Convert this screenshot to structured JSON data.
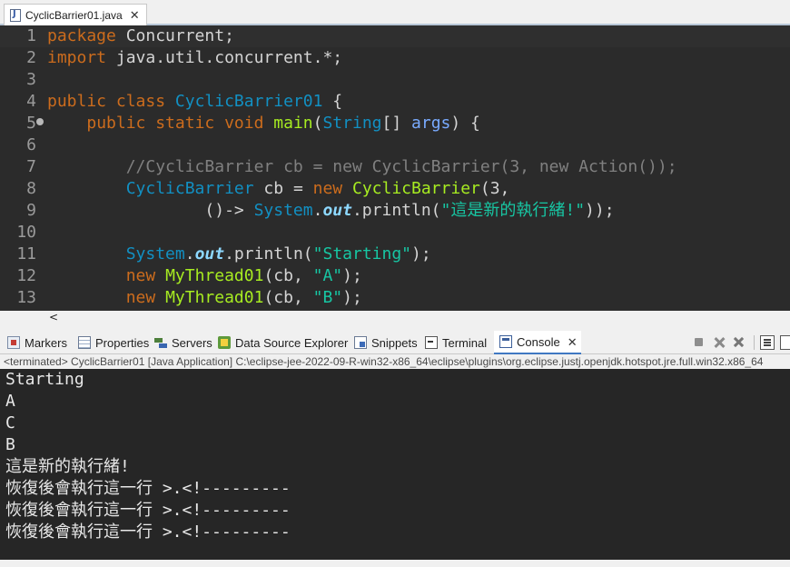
{
  "editor_tab": {
    "title": "CyclicBarrier01.java",
    "close": "✕"
  },
  "code": {
    "lines": [
      {
        "n": "1",
        "parts": [
          [
            "kw",
            "package"
          ],
          [
            "pkg",
            " Concurrent;"
          ]
        ]
      },
      {
        "n": "2",
        "parts": [
          [
            "kw",
            "import"
          ],
          [
            "pkg",
            " java.util.concurrent.*;"
          ]
        ]
      },
      {
        "n": "3",
        "parts": []
      },
      {
        "n": "4",
        "parts": [
          [
            "kw",
            "public class "
          ],
          [
            "ty",
            "CyclicBarrier01"
          ],
          [
            "pkg",
            " {"
          ]
        ]
      },
      {
        "n": "5",
        "parts": [
          [
            "pkg",
            "    "
          ],
          [
            "kw",
            "public static void "
          ],
          [
            "fn",
            "main"
          ],
          [
            "pkg",
            "("
          ],
          [
            "ty",
            "String"
          ],
          [
            "pkg",
            "[] "
          ],
          [
            "pm",
            "args"
          ],
          [
            "pkg",
            ") {"
          ]
        ]
      },
      {
        "n": "6",
        "parts": []
      },
      {
        "n": "7",
        "parts": [
          [
            "cm",
            "        //CyclicBarrier cb = new CyclicBarrier(3, new Action());"
          ]
        ]
      },
      {
        "n": "8",
        "parts": [
          [
            "pkg",
            "        "
          ],
          [
            "ty",
            "CyclicBarrier"
          ],
          [
            "pkg",
            " cb = "
          ],
          [
            "kw",
            "new "
          ],
          [
            "fn",
            "CyclicBarrier"
          ],
          [
            "pkg",
            "(3,"
          ]
        ]
      },
      {
        "n": "9",
        "parts": [
          [
            "pkg",
            "                ()-> "
          ],
          [
            "ty",
            "System"
          ],
          [
            "pkg",
            "."
          ],
          [
            "fld",
            "out"
          ],
          [
            "pkg",
            ".println("
          ],
          [
            "st",
            "\"這是新的執行緒!\""
          ],
          [
            "pkg",
            "));"
          ]
        ]
      },
      {
        "n": "10",
        "parts": []
      },
      {
        "n": "11",
        "parts": [
          [
            "pkg",
            "        "
          ],
          [
            "ty",
            "System"
          ],
          [
            "pkg",
            "."
          ],
          [
            "fld",
            "out"
          ],
          [
            "pkg",
            ".println("
          ],
          [
            "st",
            "\"Starting\""
          ],
          [
            "pkg",
            ");"
          ]
        ]
      },
      {
        "n": "12",
        "parts": [
          [
            "pkg",
            "        "
          ],
          [
            "kw",
            "new "
          ],
          [
            "fn",
            "MyThread01"
          ],
          [
            "pkg",
            "(cb, "
          ],
          [
            "st",
            "\"A\""
          ],
          [
            "pkg",
            ");"
          ]
        ]
      },
      {
        "n": "13",
        "parts": [
          [
            "pkg",
            "        "
          ],
          [
            "kw",
            "new "
          ],
          [
            "fn",
            "MyThread01"
          ],
          [
            "pkg",
            "(cb, "
          ],
          [
            "st",
            "\"B\""
          ],
          [
            "pkg",
            ");"
          ]
        ]
      }
    ]
  },
  "editor_scroll_left": "<",
  "views": {
    "tabs": [
      {
        "label": "Markers",
        "icon": "markers-icon"
      },
      {
        "label": "Properties",
        "icon": "properties-icon"
      },
      {
        "label": "Servers",
        "icon": "servers-icon"
      },
      {
        "label": "Data Source Explorer",
        "icon": "data-source-explorer-icon"
      },
      {
        "label": "Snippets",
        "icon": "snippets-icon"
      },
      {
        "label": "Terminal",
        "icon": "terminal-icon"
      },
      {
        "label": "Console",
        "icon": "console-icon",
        "active": true
      }
    ]
  },
  "console": {
    "header": "<terminated> CyclicBarrier01 [Java Application] C:\\eclipse-jee-2022-09-R-win32-x86_64\\eclipse\\plugins\\org.eclipse.justj.openjdk.hotspot.jre.full.win32.x86_64",
    "output": [
      "Starting",
      "A",
      "C",
      "B",
      "這是新的執行緒!",
      "恢復後會執行這一行 >.<!---------",
      "恢復後會執行這一行 >.<!---------",
      "恢復後會執行這一行 >.<!---------"
    ]
  },
  "colors": {
    "editor_bg": "#2b2b2b",
    "console_bg": "#262626",
    "keyword": "#cc6c1d",
    "type": "#1290c3",
    "method": "#a7ec21",
    "string": "#17c6a3",
    "comment": "#808080"
  }
}
